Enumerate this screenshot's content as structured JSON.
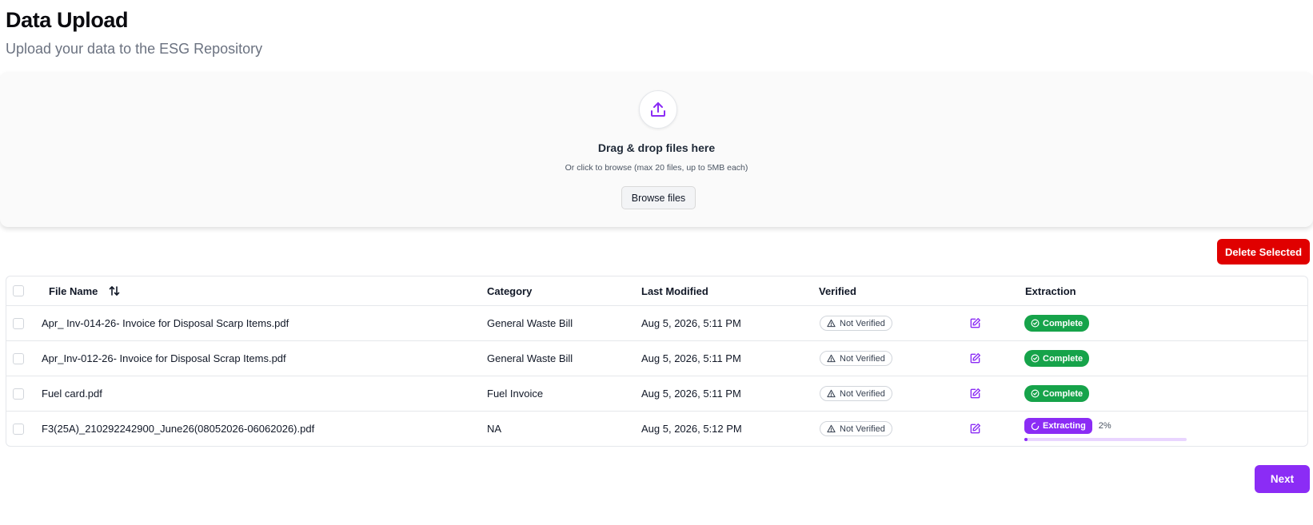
{
  "page": {
    "title": "Data Upload",
    "subtitle": "Upload your data to the ESG Repository"
  },
  "dropzone": {
    "icon": "upload-icon",
    "title": "Drag & drop files here",
    "hint": "Or click to browse (max 20 files, up to 5MB each)",
    "browse_label": "Browse files"
  },
  "actions": {
    "delete_label": "Delete Selected",
    "next_label": "Next"
  },
  "colors": {
    "accent": "#8b2cf5",
    "danger": "#e00000",
    "success": "#16a34a"
  },
  "table": {
    "columns": {
      "file_name": "File Name",
      "category": "Category",
      "last_modified": "Last Modified",
      "verified": "Verified",
      "extraction": "Extraction"
    },
    "rows": [
      {
        "file_name": "Apr_ Inv-014-26- Invoice for Disposal Scarp Items.pdf",
        "category": "General Waste Bill",
        "last_modified": "Aug 5, 2026, 5:11 PM",
        "verified": "Not Verified",
        "extraction": "Complete"
      },
      {
        "file_name": "Apr_Inv-012-26- Invoice for Disposal Scrap Items.pdf",
        "category": "General Waste Bill",
        "last_modified": "Aug 5, 2026, 5:11 PM",
        "verified": "Not Verified",
        "extraction": "Complete"
      },
      {
        "file_name": "Fuel card.pdf",
        "category": "Fuel Invoice",
        "last_modified": "Aug 5, 2026, 5:11 PM",
        "verified": "Not Verified",
        "extraction": "Complete"
      },
      {
        "file_name": "F3(25A)_210292242900_June26(08052026-06062026).pdf",
        "category": "NA",
        "last_modified": "Aug 5, 2026, 5:12 PM",
        "verified": "Not Verified",
        "extraction": "Extracting",
        "progress_label": "2%",
        "progress": 0.02
      }
    ]
  }
}
